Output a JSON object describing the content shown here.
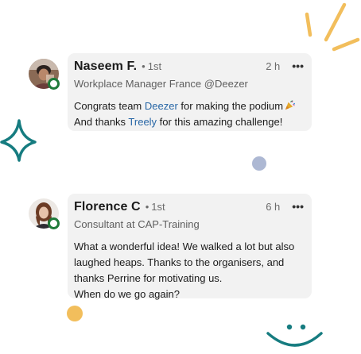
{
  "comments": [
    {
      "author": "Naseem F.",
      "separator": "•",
      "degree": "1st",
      "time": "2 h",
      "more": "•••",
      "headline": "Workplace Manager France @Deezer",
      "lines": {
        "l1_a": "Congrats team ",
        "l1_mention": "Deezer",
        "l1_b": " for making the podium",
        "l2_a": "And thanks ",
        "l2_mention": "Treely",
        "l2_b": " for this amazing challenge!"
      },
      "emoji": "party-popper-icon"
    },
    {
      "author": "Florence C",
      "separator": "•",
      "degree": "1st",
      "time": "6 h",
      "more": "•••",
      "headline": "Consultant at CAP-Training",
      "lines": {
        "l1": "What a wonderful idea! We walked a lot but also",
        "l2": "laughed heaps. Thanks to the organisers, and",
        "l3": "thanks Perrine for motivating us.",
        "l4": "When do we go again?"
      }
    }
  ],
  "colors": {
    "card_bg": "#f2f2f2",
    "mention": "#2867a6",
    "online": "#1f7a3a",
    "teal_accent": "#167c80",
    "yellow_accent": "#f2be5c",
    "blue_dot": "#adb8d3"
  }
}
